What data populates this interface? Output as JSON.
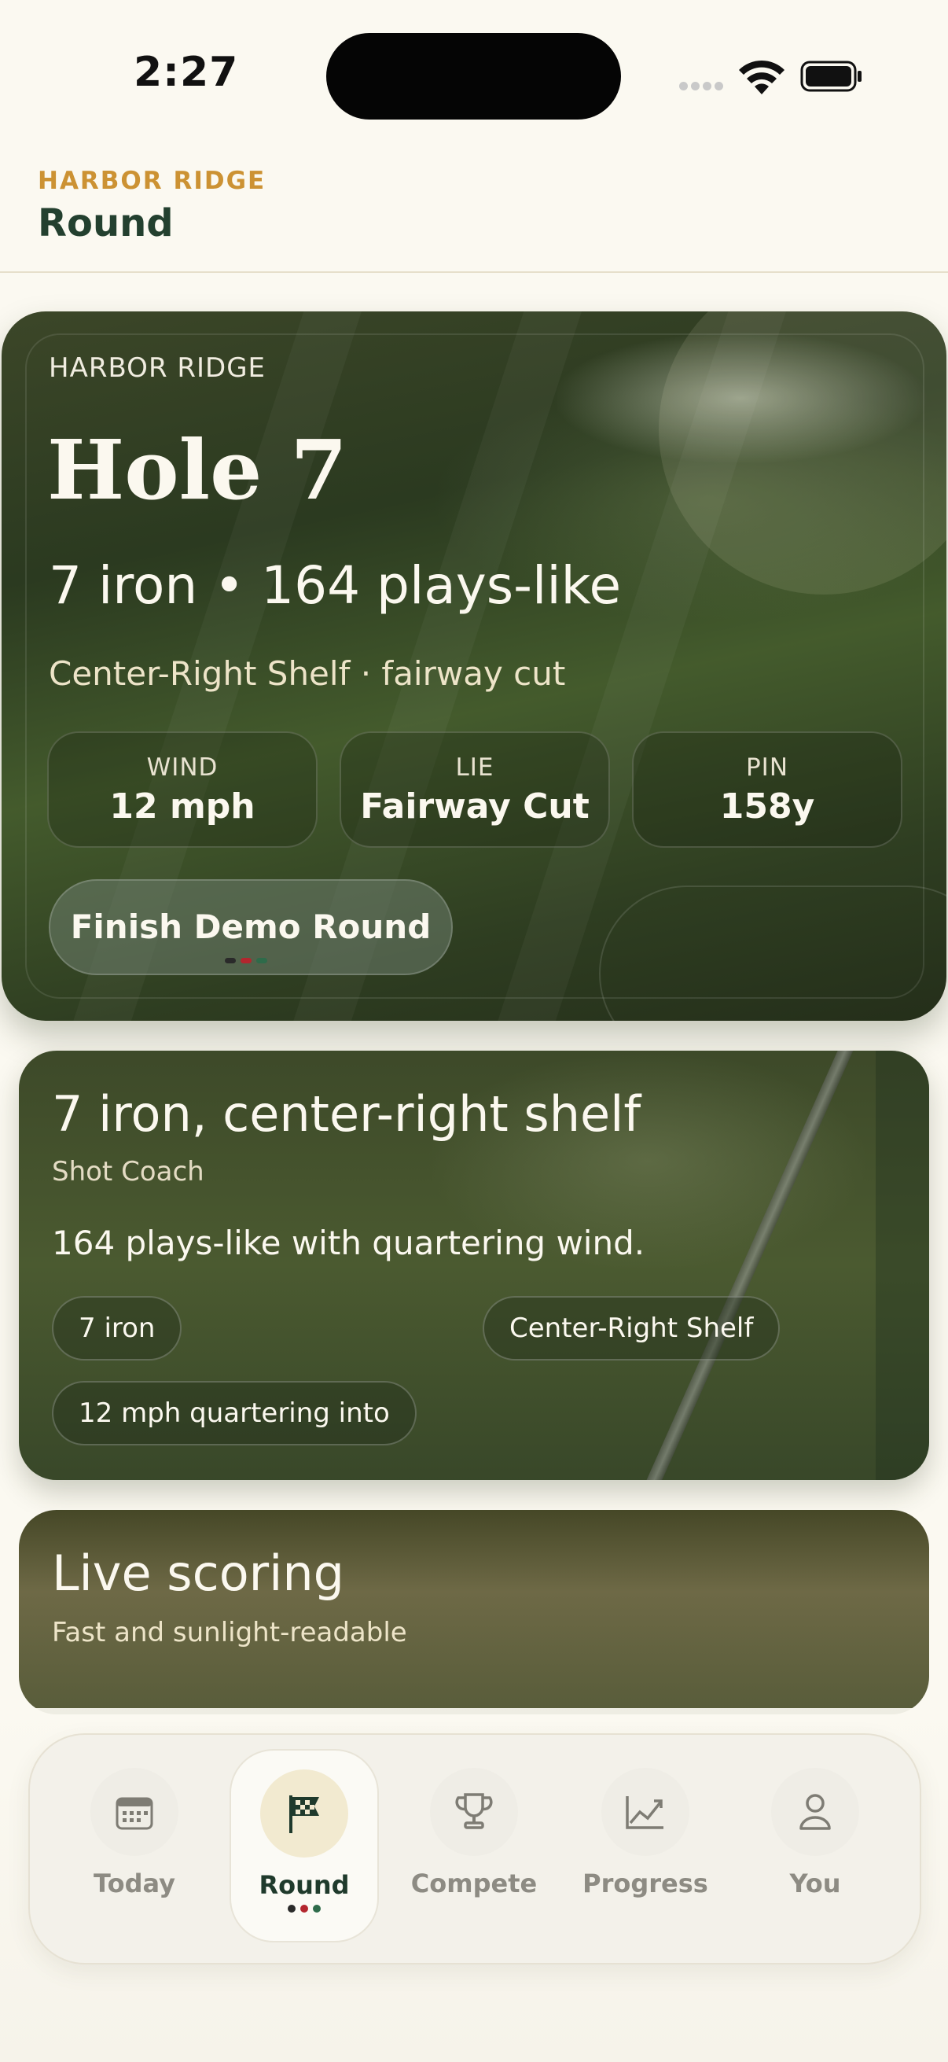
{
  "status_bar": {
    "time": "2:27"
  },
  "header": {
    "eyebrow": "HARBOR RIDGE",
    "title": "Round"
  },
  "hero": {
    "course": "HARBOR RIDGE",
    "title": "Hole 7",
    "club_line": "7 iron • 164 plays-like",
    "target_line": "Center-Right Shelf · fairway cut",
    "stats": [
      {
        "label": "WIND",
        "value": "12 mph"
      },
      {
        "label": "LIE",
        "value": "Fairway Cut"
      },
      {
        "label": "PIN",
        "value": "158y"
      }
    ],
    "finish_button": "Finish Demo Round"
  },
  "coach": {
    "title": "7 iron, center-right shelf",
    "subtitle": "Shot Coach",
    "body": "164 plays-like with quartering wind.",
    "chips": [
      "7 iron",
      "Center-Right Shelf",
      "12 mph quartering into"
    ]
  },
  "live_scoring": {
    "title": "Live scoring",
    "subtitle": "Fast and sunlight-readable"
  },
  "tabs": [
    {
      "label": "Today",
      "icon": "calendar-icon"
    },
    {
      "label": "Round",
      "icon": "checkered-flag-icon",
      "active": true
    },
    {
      "label": "Compete",
      "icon": "trophy-icon"
    },
    {
      "label": "Progress",
      "icon": "chart-icon"
    },
    {
      "label": "You",
      "icon": "person-icon"
    }
  ],
  "colors": {
    "accent": "#cc9233",
    "primary": "#1f3a2c",
    "dot_red": "#b3262e",
    "dot_green": "#2e6b4a"
  }
}
